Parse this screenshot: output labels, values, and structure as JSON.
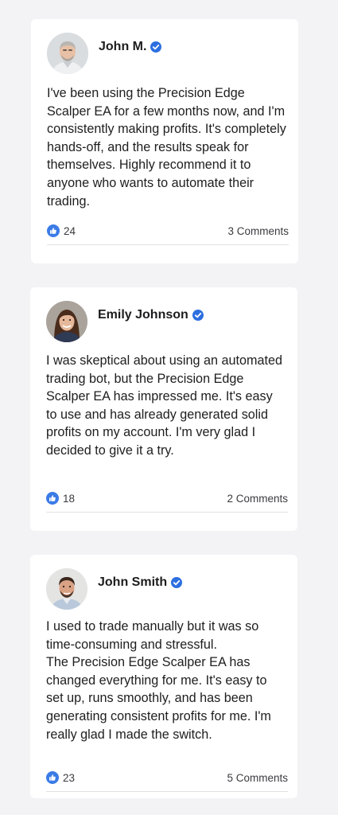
{
  "colors": {
    "background": "#f3f3f5",
    "card": "#ffffff",
    "verified_badge": "#2d6fe0",
    "like_badge": "#3b7be6",
    "text": "#1e1e20",
    "muted": "#3b3b40"
  },
  "reviews": [
    {
      "name": "John M.",
      "avatar": "avatar-photo",
      "badge_icon": "verified-badge-icon",
      "text": "I've been using the Precision Edge Scalper EA for a few months now, and I'm consistently making profits. It's completely hands-off, and the results speak for themselves. Highly recommend it to anyone who wants to automate their trading.",
      "likes": "24",
      "comments": "3 Comments"
    },
    {
      "name": "Emily Johnson",
      "avatar": "avatar-photo",
      "badge_icon": "verified-badge-icon",
      "text": "I was skeptical about using an automated trading bot, but the Precision Edge Scalper EA has impressed me. It's easy to use and has already generated solid profits on my account. I'm very glad I decided to give it a try.",
      "likes": "18",
      "comments": "2 Comments"
    },
    {
      "name": "John Smith",
      "avatar": "avatar-photo",
      "badge_icon": "verified-badge-icon",
      "text": "I used to trade manually but it was so time-consuming and stressful.\nThe Precision Edge Scalper EA has changed everything for me. It's easy to set up, runs smoothly, and has been generating consistent profits for me. I'm really glad I made the switch.",
      "likes": "23",
      "comments": "5 Comments"
    }
  ]
}
